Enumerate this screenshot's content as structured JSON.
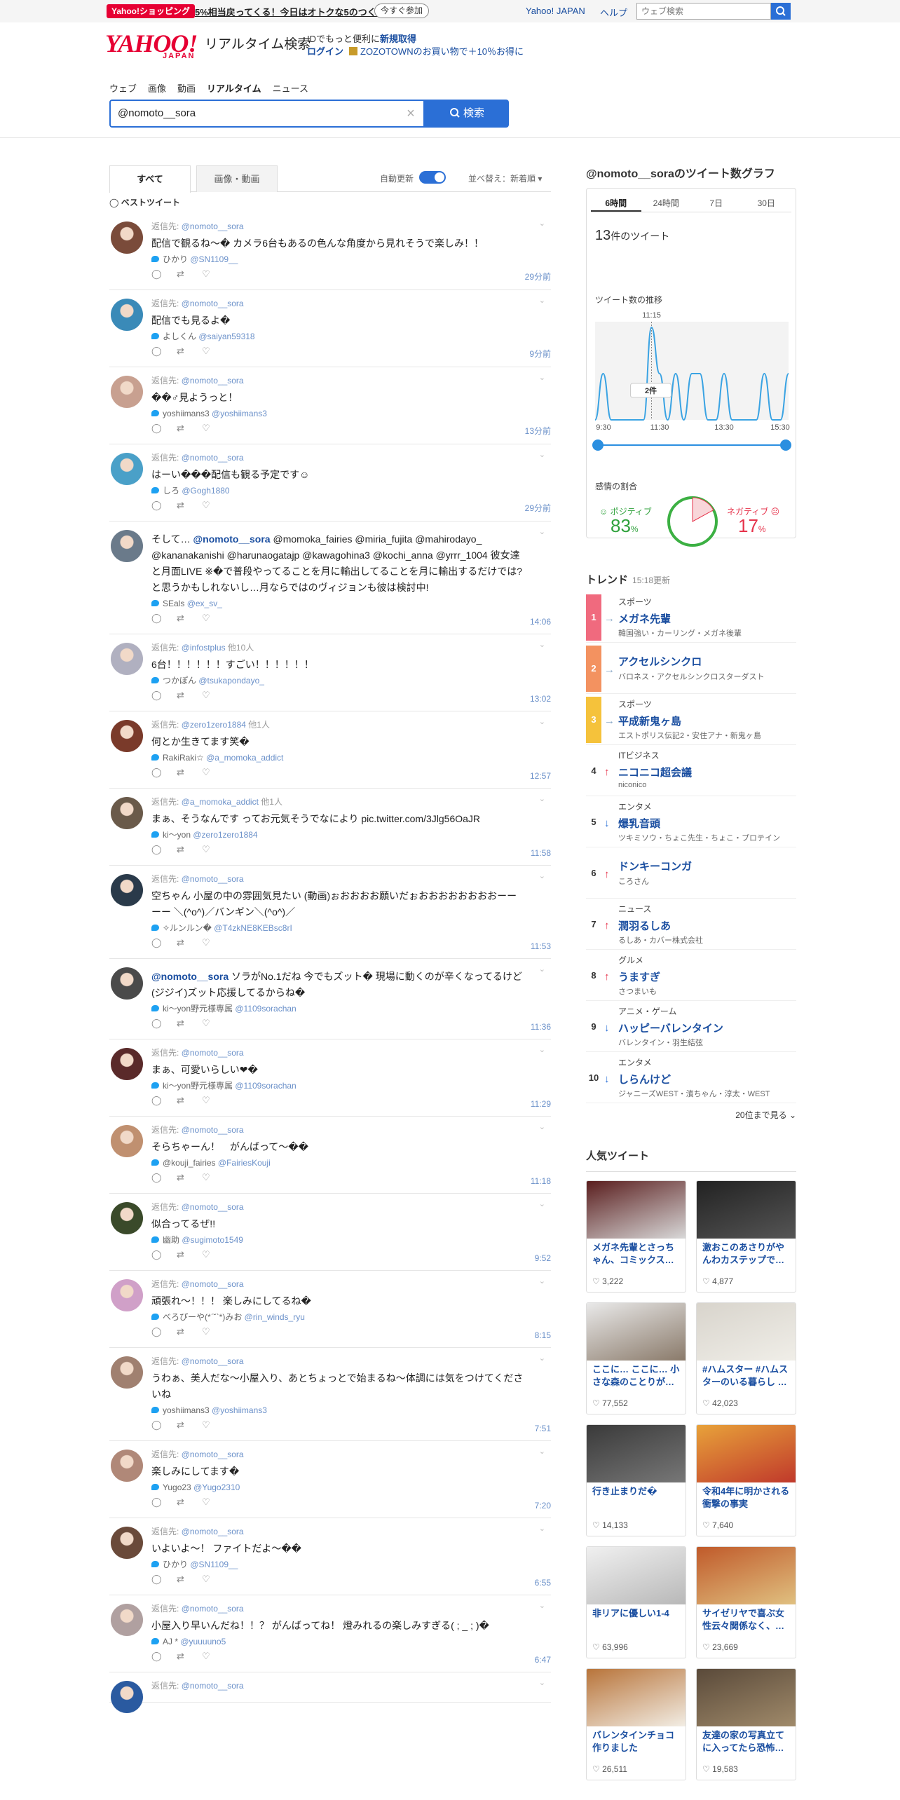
{
  "topbar": {
    "promo_badge": "Yahoo!ショッピング",
    "promo_text": "5%相当戻ってくる！今日はオトクな5のつく日",
    "promo_button": "今すぐ参加",
    "yahoo_japan": "Yahoo! JAPAN",
    "help": "ヘルプ",
    "web_search_placeholder": "ウェブ検索"
  },
  "header": {
    "logo": "YAHOO!",
    "logo_sub": "JAPAN",
    "site_title": "リアルタイム検索",
    "id_note": "IDでもっと便利に",
    "id_link": "新規取得",
    "login": "ログイン",
    "zozo": "ZOZOTOWNのお買い物で＋10％お得に"
  },
  "nav": [
    "ウェブ",
    "画像",
    "動画",
    "リアルタイム",
    "ニュース"
  ],
  "search": {
    "value": "@nomoto__sora",
    "button": "検索"
  },
  "tabs": {
    "all": "すべて",
    "media": "画像・動画",
    "auto_update": "自動更新",
    "sort": "並べ替え：新着順"
  },
  "best_tweet": "ベストツイート",
  "tweets": [
    {
      "reply": "返信先:",
      "to": "@nomoto__sora",
      "to_extra": "",
      "body": "配信で観るね〜� カメラ6台もあるの色んな角度から見れそうで楽しみ！！",
      "name": "ひかり",
      "handle": "@SN1109__",
      "time": "29分前"
    },
    {
      "reply": "返信先:",
      "to": "@nomoto__sora",
      "to_extra": "",
      "body": "配信でも見るよ�",
      "name": "よしくん",
      "handle": "@saiyan59318",
      "time": "9分前"
    },
    {
      "reply": "返信先:",
      "to": "@nomoto__sora",
      "to_extra": "",
      "body": "��♂見ようっと！",
      "name": "yoshiimans3",
      "handle": "@yoshiimans3",
      "time": "13分前"
    },
    {
      "reply": "返信先:",
      "to": "@nomoto__sora",
      "to_extra": "",
      "body": "はーい���配信も観る予定です☺",
      "name": "しろ",
      "handle": "@Gogh1880",
      "time": "29分前"
    },
    {
      "reply": "",
      "to": "",
      "to_extra": "",
      "body_prefix": "そして… ",
      "body_mention": "@nomoto__sora",
      "body": "@momoka_fairies @miria_fujita @mahirodayo_ @kananakanishi @harunaogatajp @kawagohina3 @kochi_anna @yrrr_1004 彼女達と月面LIVE ※�で普段やってることを月に輸出してることを月に輸出するだけでは? と思うかもしれないし…月ならではのヴィジョンも彼は検討中!",
      "name": "SEals",
      "handle": "@ex_sv_",
      "time": "14:06"
    },
    {
      "reply": "返信先:",
      "to": "@infostplus",
      "to_extra": "他10人",
      "body": "6台！！！！！！すごい！！！！！！",
      "name": "つかぽん",
      "handle": "@tsukapondayo_",
      "time": "13:02"
    },
    {
      "reply": "返信先:",
      "to": "@zero1zero1884",
      "to_extra": "他1人",
      "body": "何とか生きてます笑�",
      "name": "RakiRaki☆",
      "handle": "@a_momoka_addict",
      "time": "12:57"
    },
    {
      "reply": "返信先:",
      "to": "@a_momoka_addict",
      "to_extra": "他1人",
      "body": "まぁ、そうなんです ってお元気そうでなにより pic.twitter.com/3Jlg56OaJR",
      "name": "ki〜yon",
      "handle": "@zero1zero1884",
      "time": "11:58"
    },
    {
      "reply": "返信先:",
      "to": "@nomoto__sora",
      "to_extra": "",
      "body": "空ちゃん 小屋の中の雰囲気見たい (動画)ぉおおおお願いだぉおおおおおおおおーーーー ＼(^o^)／バンギン＼(^o^)／",
      "name": "✧ルンルン�",
      "handle": "@T4zkNE8KEBsc8rI",
      "time": "11:53"
    },
    {
      "reply": "",
      "to": "",
      "to_extra": "",
      "body_prefix": "",
      "body_mention": "@nomoto__sora",
      "body": " ソラがNo.1だね 今でもズット� 現場に動くのが辛くなってるけど(ジジイ)ズット応援してるからね�",
      "name": "ki〜yon野元様専属",
      "handle": "@1109sorachan",
      "time": "11:36"
    },
    {
      "reply": "返信先:",
      "to": "@nomoto__sora",
      "to_extra": "",
      "body": "まぁ、可愛いらしい❤�",
      "name": "ki〜yon野元様専属",
      "handle": "@1109sorachan",
      "time": "11:29"
    },
    {
      "reply": "返信先:",
      "to": "@nomoto__sora",
      "to_extra": "",
      "body": "そらちゃーん！　がんばって～��",
      "name": "@kouji_fairies",
      "handle": "@FairiesKouji",
      "time": "11:18"
    },
    {
      "reply": "返信先:",
      "to": "@nomoto__sora",
      "to_extra": "",
      "body": "似合ってるぜ!!",
      "name": "幽助",
      "handle": "@sugimoto1549",
      "time": "9:52"
    },
    {
      "reply": "返信先:",
      "to": "@nomoto__sora",
      "to_extra": "",
      "body": "頑張れ〜！！！ 楽しみにしてるね�",
      "name": "べろぴーや(*ˊ˘ˋ*)みお",
      "handle": "@rin_winds_ryu",
      "time": "8:15"
    },
    {
      "reply": "返信先:",
      "to": "@nomoto__sora",
      "to_extra": "",
      "body": "うわぁ、美人だな〜小屋入り、あとちょっとで始まるね〜体調には気をつけてくださいね",
      "name": "yoshiimans3",
      "handle": "@yoshiimans3",
      "time": "7:51"
    },
    {
      "reply": "返信先:",
      "to": "@nomoto__sora",
      "to_extra": "",
      "body": "楽しみにしてます�",
      "name": "Yugo23",
      "handle": "@Yugo2310",
      "time": "7:20"
    },
    {
      "reply": "返信先:",
      "to": "@nomoto__sora",
      "to_extra": "",
      "body": "いよいよ〜！ ファイトだよ〜��",
      "name": "ひかり",
      "handle": "@SN1109__",
      "time": "6:55"
    },
    {
      "reply": "返信先:",
      "to": "@nomoto__sora",
      "to_extra": "",
      "body": "小屋入り早いんだね！！？ がんばってね！ 燈みれるの楽しみすぎる( ; _ ; )�",
      "name": "AJ *",
      "handle": "@yuuuuno5",
      "time": "6:47"
    },
    {
      "reply": "返信先:",
      "to": "@nomoto__sora",
      "to_extra": "",
      "body": "",
      "name": "",
      "handle": "",
      "time": ""
    }
  ],
  "graph": {
    "title": "@nomoto__soraのツイート数グラフ",
    "ranges": [
      "6時間",
      "24時間",
      "7日",
      "30日"
    ],
    "count_num": "13",
    "count_unit": "件のツイート",
    "trend_title": "ツイート数の推移",
    "peak_time": "11:15",
    "peak_label": "2件",
    "x_labels": [
      "9:30",
      "11:30",
      "13:30",
      "15:30"
    ],
    "sentiment_title": "感情の割合",
    "positive_label": "ポジティブ",
    "positive_value": "83",
    "negative_label": "ネガティブ",
    "negative_value": "17",
    "percent": "%",
    "line_color": "#3aa3e3"
  },
  "chart_data": {
    "type": "line",
    "x": [
      "9:30",
      "9:45",
      "10:00",
      "10:15",
      "10:30",
      "10:45",
      "11:00",
      "11:15",
      "11:30",
      "11:45",
      "12:00",
      "12:15",
      "12:30",
      "12:45",
      "13:00",
      "13:15",
      "13:30",
      "13:45",
      "14:00",
      "14:15",
      "14:30",
      "14:45",
      "15:00",
      "15:15",
      "15:30"
    ],
    "values": [
      0,
      1,
      0,
      0,
      0,
      0,
      0,
      2,
      1,
      0,
      1,
      0,
      1,
      1,
      0,
      0,
      1,
      0,
      0,
      0,
      0,
      1,
      0,
      0,
      1
    ],
    "ylim": [
      0,
      2
    ]
  },
  "trend": {
    "title": "トレンド",
    "updated": "15:18更新",
    "items": [
      {
        "rank": "1",
        "cat": "スポーツ",
        "arrow": "→",
        "word": "メガネ先輩",
        "sub": "韓国強い・カーリング・メガネ後輩",
        "color": "#f06a7e",
        "acolor": "#8aa8c8"
      },
      {
        "rank": "2",
        "cat": "",
        "arrow": "→",
        "word": "アクセルシンクロ",
        "sub": "バロネス・アクセルシンクロスターダスト",
        "color": "#f39260",
        "acolor": "#8aa8c8"
      },
      {
        "rank": "3",
        "cat": "スポーツ",
        "arrow": "→",
        "word": "平成新鬼ヶ島",
        "sub": "エストポリス伝記2・安住アナ・新鬼ヶ島",
        "color": "#f5c23b",
        "acolor": "#8aa8c8"
      },
      {
        "rank": "4",
        "cat": "ITビジネス",
        "arrow": "↑",
        "word": "ニコニコ超会議",
        "sub": "niconico",
        "color": "",
        "acolor": "#e6334b"
      },
      {
        "rank": "5",
        "cat": "エンタメ",
        "arrow": "↓",
        "word": "爆乳音頭",
        "sub": "ツキミソウ・ちょこ先生・ちょこ・プロテイン",
        "color": "",
        "acolor": "#2b6fd6"
      },
      {
        "rank": "6",
        "cat": "",
        "arrow": "↑",
        "word": "ドンキーコンガ",
        "sub": "ころさん",
        "color": "",
        "acolor": "#e6334b"
      },
      {
        "rank": "7",
        "cat": "ニュース",
        "arrow": "↑",
        "word": "潤羽るしあ",
        "sub": "るしあ・カバー株式会社",
        "color": "",
        "acolor": "#e6334b"
      },
      {
        "rank": "8",
        "cat": "グルメ",
        "arrow": "↑",
        "word": "うますぎ",
        "sub": "さつまいも",
        "color": "",
        "acolor": "#e6334b"
      },
      {
        "rank": "9",
        "cat": "アニメ・ゲーム",
        "arrow": "↓",
        "word": "ハッピーバレンタイン",
        "sub": "バレンタイン・羽生結弦",
        "color": "",
        "acolor": "#2b6fd6"
      },
      {
        "rank": "10",
        "cat": "エンタメ",
        "arrow": "↓",
        "word": "しらんけど",
        "sub": "ジャニーズWEST・濱ちゃん・淳太・WEST",
        "color": "",
        "acolor": "#2b6fd6"
      }
    ],
    "more": "20位まで見る"
  },
  "popular": {
    "title": "人気ツイート",
    "items": [
      {
        "cap": "メガネ先輩とさっちゃん、コミックス…",
        "likes": "3,222",
        "c1": "#5a1e1e",
        "c2": "#d8d8d8"
      },
      {
        "cap": "激おこのあさりがやんわカステップで…",
        "likes": "4,877",
        "c1": "#222",
        "c2": "#555"
      },
      {
        "cap": "ここに… ここに… 小さな森のことりが…",
        "likes": "77,552",
        "c1": "#e9e9e9",
        "c2": "#8a7a6a"
      },
      {
        "cap": "#ハムスター #ハムスターのいる暮らし …",
        "likes": "42,023",
        "c1": "#d8d4cc",
        "c2": "#f0eee8"
      },
      {
        "cap": "行き止まりだ�",
        "likes": "14,133",
        "c1": "#3a3a3a",
        "c2": "#777"
      },
      {
        "cap": "令和4年に明かされる衝撃の事実",
        "likes": "7,640",
        "c1": "#e8a23a",
        "c2": "#c0392b"
      },
      {
        "cap": "非リアに優しい1-4",
        "likes": "63,996",
        "c1": "#f0f0f0",
        "c2": "#b8b8b8"
      },
      {
        "cap": "サイゼリヤで喜ぶ女性云々関係なく、…",
        "likes": "23,669",
        "c1": "#c05a2a",
        "c2": "#e0c080"
      },
      {
        "cap": "バレンタインチョコ作りました",
        "likes": "26,511",
        "c1": "#b8743a",
        "c2": "#f2ede4"
      },
      {
        "cap": "友達の家の写真立てに入ってたら恐怖…",
        "likes": "19,583",
        "c1": "#5a4a3a",
        "c2": "#a08a6a"
      }
    ]
  }
}
